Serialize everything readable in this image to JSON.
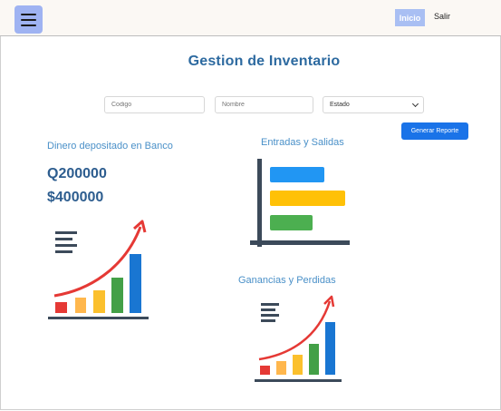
{
  "navbar": {
    "menu_icon": "hamburger-menu-icon",
    "inicio_label": "Inicio",
    "salir_label": "Salir",
    "inicio_bg": "#a9bff3",
    "menu_bg": "#9fb3f2"
  },
  "page": {
    "title": "Gestion de Inventario",
    "title_color": "#2d6aa0"
  },
  "filters": {
    "codigo_placeholder": "Codigo",
    "nombre_placeholder": "Nombre",
    "estado_selected": "Estado"
  },
  "actions": {
    "report_label": "Generar Reporte",
    "report_color": "#1a73e8"
  },
  "cards": {
    "deposit": {
      "title": "Dinero depositado en Banco",
      "amount_1": "Q200000",
      "amount_2": "$400000",
      "icon": "growth-bar-chart-icon"
    },
    "io": {
      "title": "Entradas y Salidas",
      "icon": "horizontal-bar-chart-icon"
    },
    "profit": {
      "title": "Ganancias y Perdidas",
      "icon": "growth-bar-chart-icon"
    }
  }
}
